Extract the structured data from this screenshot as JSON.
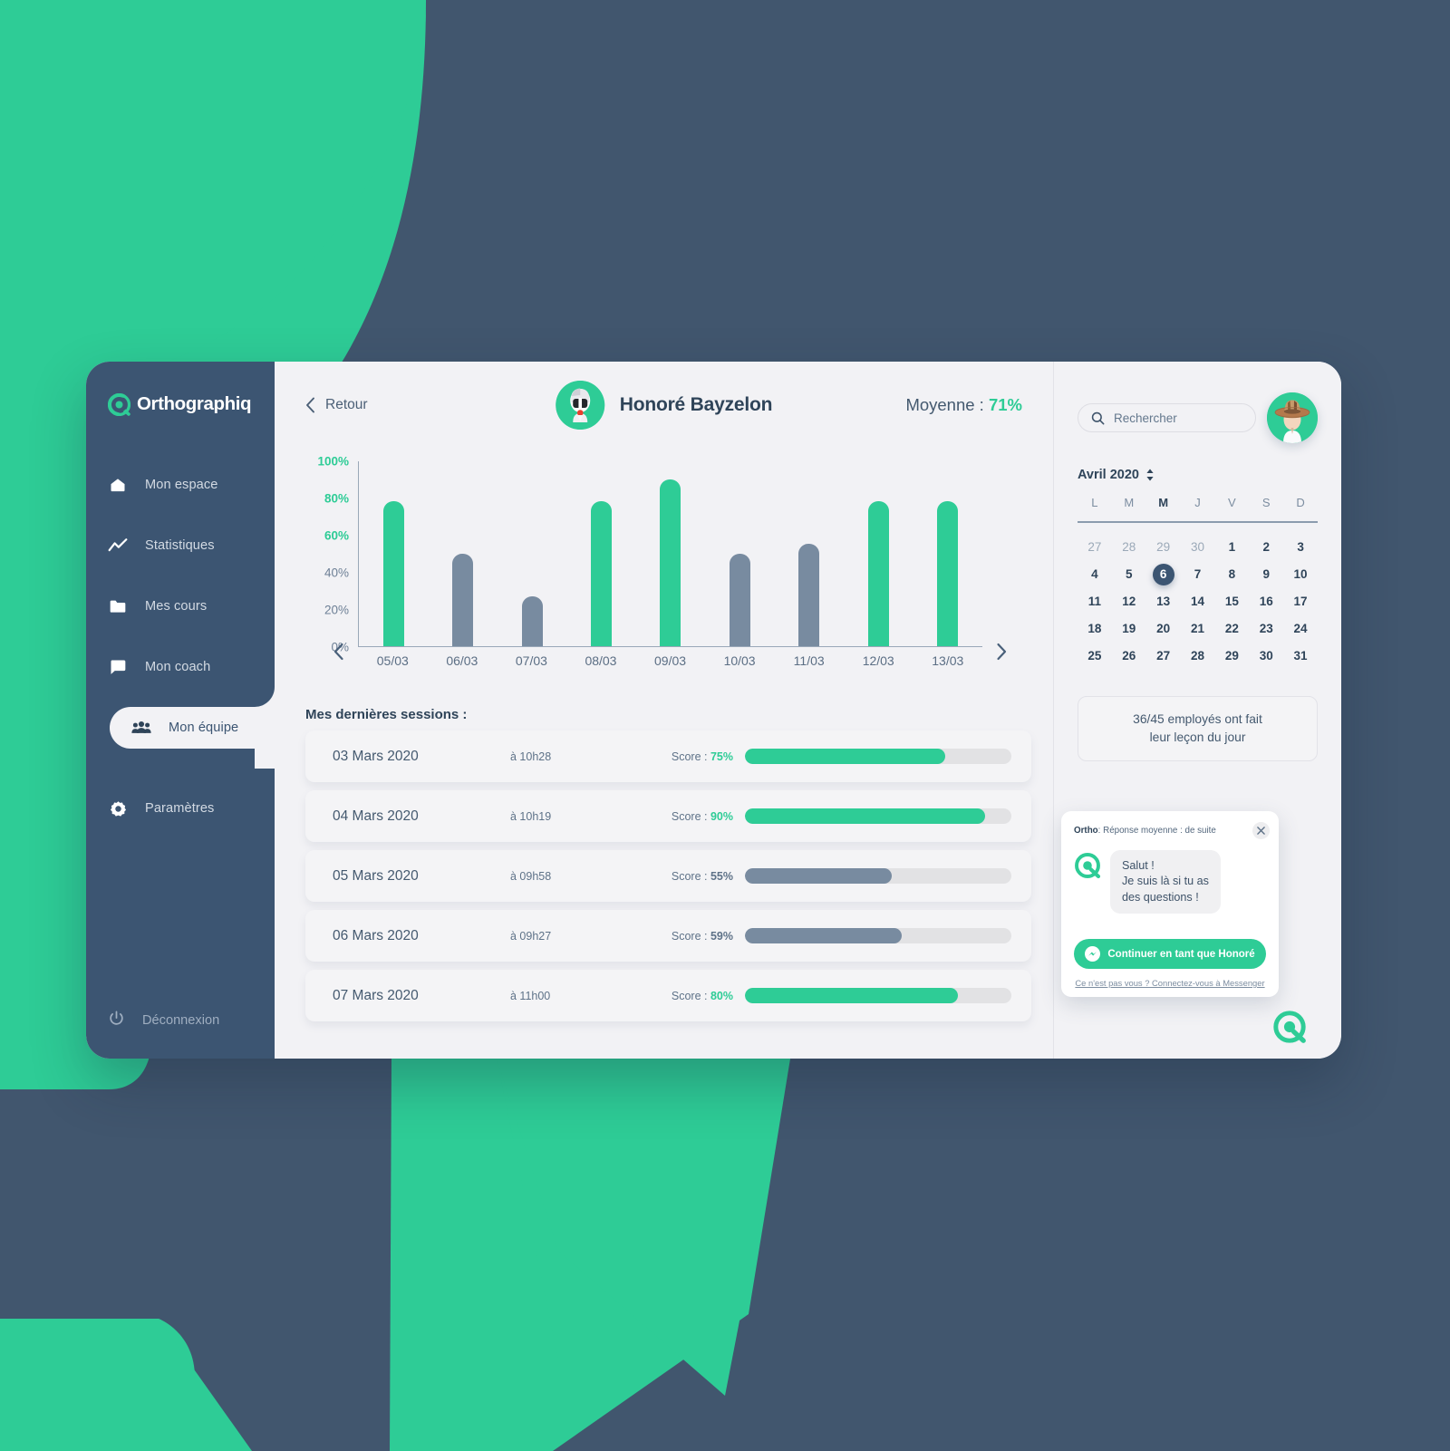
{
  "brand": {
    "name": "Orthographiq",
    "green": "#2ECC96",
    "dark": "#3C5572",
    "gray_bar": "#788BA0"
  },
  "sidebar": {
    "items": [
      {
        "label": "Mon espace",
        "icon": "home-icon",
        "active": false
      },
      {
        "label": "Statistiques",
        "icon": "chart-line-icon",
        "active": false
      },
      {
        "label": "Mes cours",
        "icon": "folder-icon",
        "active": false
      },
      {
        "label": "Mon coach",
        "icon": "chat-bubble-icon",
        "active": false
      },
      {
        "label": "Mon équipe",
        "icon": "people-icon",
        "active": true
      },
      {
        "label": "Paramètres",
        "icon": "gear-icon",
        "active": false
      }
    ],
    "logout": {
      "label": "Déconnexion",
      "icon": "power-icon"
    }
  },
  "topbar": {
    "back_label": "Retour",
    "back_icon": "chevron-left-icon",
    "person_name": "Honoré Bayzelon",
    "avatar": "helmet-avatar",
    "average_label": "Moyenne :",
    "average_value": "71%"
  },
  "chart_data": {
    "type": "bar",
    "title": "",
    "xlabel": "",
    "ylabel": "",
    "ylim": [
      0,
      100
    ],
    "categories": [
      "05/03",
      "06/03",
      "07/03",
      "08/03",
      "09/03",
      "10/03",
      "11/03",
      "12/03",
      "13/03"
    ],
    "values": [
      78,
      50,
      27,
      78,
      90,
      50,
      55,
      78,
      78
    ],
    "ytick_labels": [
      "100%",
      "80%",
      "60%",
      "40%",
      "20%",
      "0%"
    ],
    "ytick_values": [
      100,
      80,
      60,
      40,
      20,
      0
    ],
    "highlighted_yticks": [
      "100%",
      "80%",
      "60%"
    ],
    "bar_colors": [
      "#2ECC96",
      "#788BA0",
      "#788BA0",
      "#2ECC96",
      "#2ECC96",
      "#788BA0",
      "#788BA0",
      "#2ECC96",
      "#2ECC96"
    ],
    "threshold": 70,
    "grid": false,
    "legend": "none",
    "prev_icon": "chevron-left-icon",
    "next_icon": "chevron-right-icon"
  },
  "sessions": {
    "title": "Mes dernières sessions :",
    "score_prefix": "Score :",
    "rows": [
      {
        "date": "03 Mars 2020",
        "time": "à 10h28",
        "score": "75%",
        "value": 75
      },
      {
        "date": "04 Mars 2020",
        "time": "à 10h19",
        "score": "90%",
        "value": 90
      },
      {
        "date": "05 Mars 2020",
        "time": "à 09h58",
        "score": "55%",
        "value": 55
      },
      {
        "date": "06 Mars 2020",
        "time": "à 09h27",
        "score": "59%",
        "value": 59
      },
      {
        "date": "07 Mars 2020",
        "time": "à 11h00",
        "score": "80%",
        "value": 80
      }
    ]
  },
  "rail": {
    "search": {
      "placeholder": "Rechercher",
      "icon": "search-icon"
    },
    "avatar": "cowboy-avatar",
    "calendar": {
      "month_label": "Avril 2020",
      "selector_icon": "updown-arrows-icon",
      "dow": [
        "L",
        "M",
        "M",
        "J",
        "V",
        "S",
        "D"
      ],
      "current_dow_index": 2,
      "selected_day": 6,
      "weeks": [
        [
          {
            "d": "27",
            "out": true
          },
          {
            "d": "28",
            "out": true
          },
          {
            "d": "29",
            "out": true
          },
          {
            "d": "30",
            "out": true
          },
          {
            "d": "1",
            "out": false
          },
          {
            "d": "2",
            "out": false
          },
          {
            "d": "3",
            "out": false
          }
        ],
        [
          {
            "d": "4",
            "out": false
          },
          {
            "d": "5",
            "out": false
          },
          {
            "d": "6",
            "out": false
          },
          {
            "d": "7",
            "out": false
          },
          {
            "d": "8",
            "out": false
          },
          {
            "d": "9",
            "out": false
          },
          {
            "d": "10",
            "out": false
          }
        ],
        [
          {
            "d": "11",
            "out": false
          },
          {
            "d": "12",
            "out": false
          },
          {
            "d": "13",
            "out": false
          },
          {
            "d": "14",
            "out": false
          },
          {
            "d": "15",
            "out": false
          },
          {
            "d": "16",
            "out": false
          },
          {
            "d": "17",
            "out": false
          }
        ],
        [
          {
            "d": "18",
            "out": false
          },
          {
            "d": "19",
            "out": false
          },
          {
            "d": "20",
            "out": false
          },
          {
            "d": "21",
            "out": false
          },
          {
            "d": "22",
            "out": false
          },
          {
            "d": "23",
            "out": false
          },
          {
            "d": "24",
            "out": false
          }
        ],
        [
          {
            "d": "25",
            "out": false
          },
          {
            "d": "26",
            "out": false
          },
          {
            "d": "27",
            "out": false
          },
          {
            "d": "28",
            "out": false
          },
          {
            "d": "29",
            "out": false
          },
          {
            "d": "30",
            "out": false
          },
          {
            "d": "31",
            "out": false
          }
        ]
      ]
    },
    "stat_card_line1": "36/45 employés ont fait",
    "stat_card_line2": "leur leçon du jour"
  },
  "chat": {
    "sender": "Ortho",
    "meta": ": Réponse moyenne : de suite",
    "close_icon": "close-icon",
    "logo_icon": "ortho-logo-icon",
    "message_line1": "Salut !",
    "message_line2": "Je suis là si tu as",
    "message_line3": "des questions !",
    "cta_label": "Continuer en tant que Honoré",
    "cta_icon": "messenger-icon",
    "link_label": "Ce n'est pas vous ? Connectez-vous à Messenger",
    "fab_icon": "ortho-logo-icon"
  }
}
